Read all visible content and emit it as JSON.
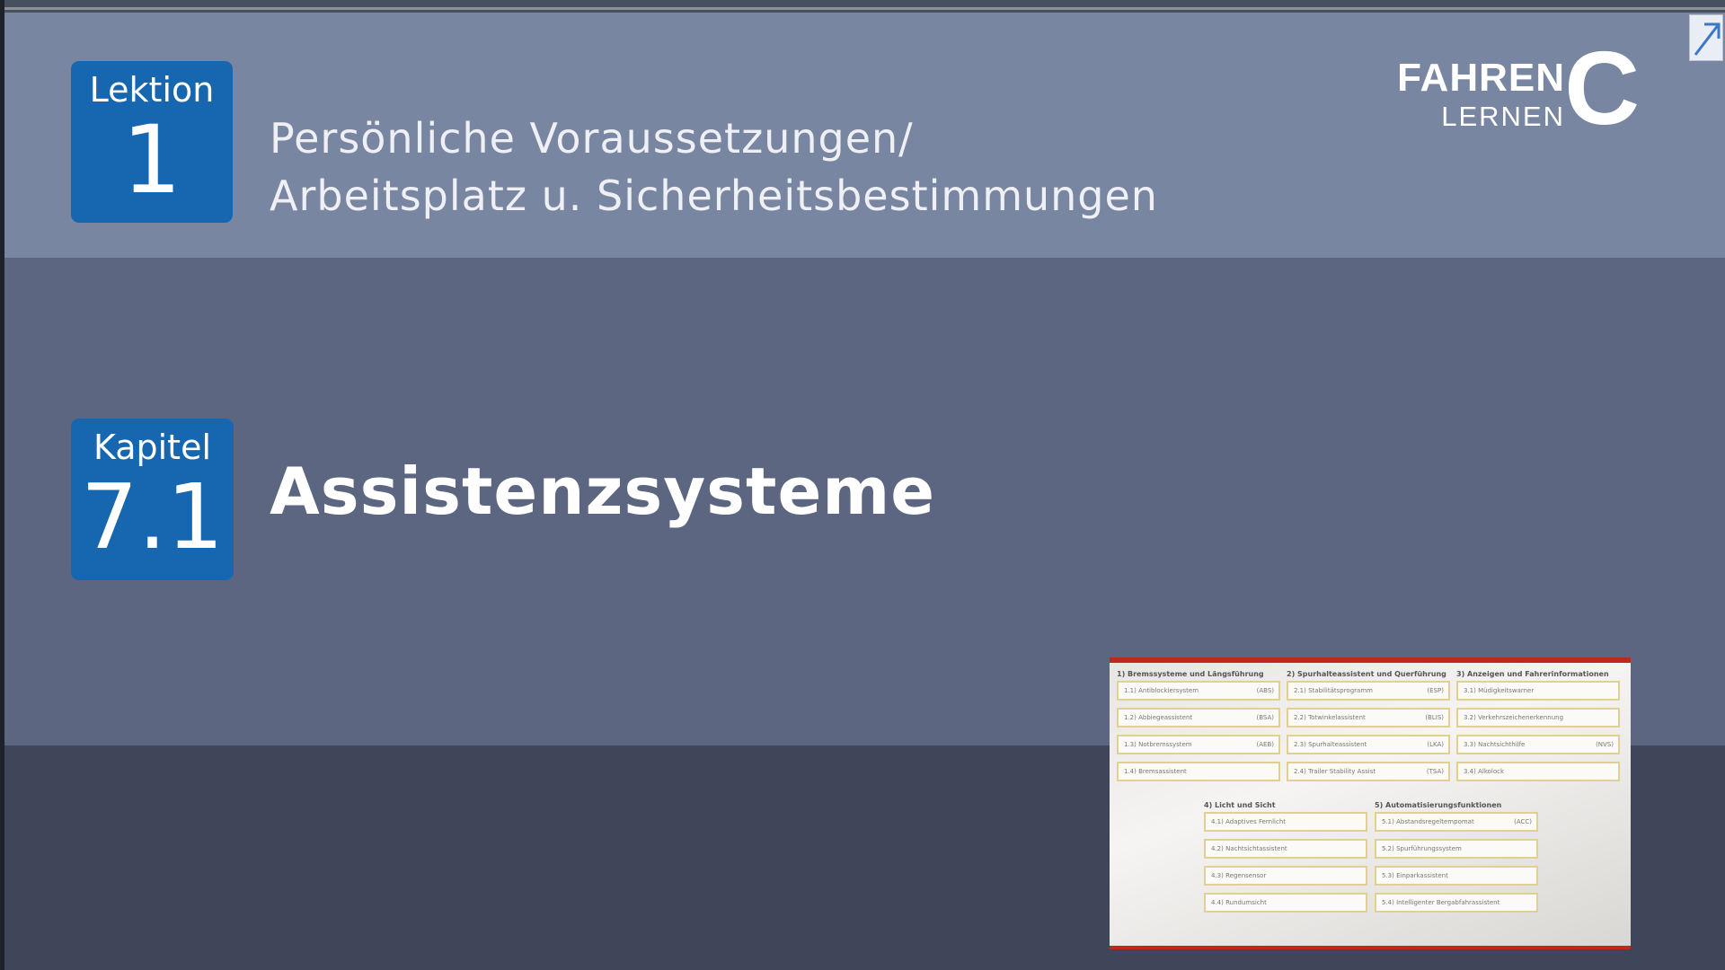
{
  "lesson": {
    "label": "Lektion",
    "number": "1",
    "title_line1": "Persönliche Voraussetzungen/",
    "title_line2": "Arbeitsplatz u. Sicherheitsbestimmungen"
  },
  "chapter": {
    "label": "Kapitel",
    "number": "7.1",
    "title": "Assistenzsysteme"
  },
  "brand": {
    "line1": "FAHREN",
    "line2": "LERNEN",
    "mark": "C"
  },
  "icons": {
    "corner": "expand-arrow-icon"
  },
  "colors": {
    "header_band": "#7886a1",
    "mid_band": "#5c6680",
    "bottom_band": "#404659",
    "badge_blue": "#1766b0",
    "thumbnail_accent": "#c0271e",
    "cell_border": "#e2cf92"
  },
  "thumbnail": {
    "sections": [
      {
        "heading": "1) Bremssysteme und Längsführung",
        "items": [
          {
            "label": "1.1) Antiblockiersystem",
            "code": "(ABS)"
          },
          {
            "label": "1.2) Abbiegeassistent",
            "code": "(BSA)"
          },
          {
            "label": "1.3) Notbremssystem",
            "code": "(AEB)"
          },
          {
            "label": "1.4) Bremsassistent",
            "code": ""
          }
        ]
      },
      {
        "heading": "2) Spurhalteassistent und Querführung",
        "items": [
          {
            "label": "2.1) Stabilitätsprogramm",
            "code": "(ESP)"
          },
          {
            "label": "2.2) Totwinkelassistent",
            "code": "(BLIS)"
          },
          {
            "label": "2.3) Spurhalteassistent",
            "code": "(LKA)"
          },
          {
            "label": "2.4) Trailer Stability Assist",
            "code": "(TSA)"
          }
        ]
      },
      {
        "heading": "3) Anzeigen und Fahrerinformationen",
        "items": [
          {
            "label": "3.1) Müdigkeitswarner",
            "code": ""
          },
          {
            "label": "3.2) Verkehrszeichenerkennung",
            "code": ""
          },
          {
            "label": "3.3) Nachtsichthilfe",
            "code": "(NVS)"
          },
          {
            "label": "3.4) Alkolock",
            "code": ""
          }
        ]
      },
      {
        "heading": "4) Licht und Sicht",
        "items": [
          {
            "label": "4.1) Adaptives Fernlicht",
            "code": ""
          },
          {
            "label": "4.2) Nachtsichtassistent",
            "code": ""
          },
          {
            "label": "4.3) Regensensor",
            "code": ""
          },
          {
            "label": "4.4) Rundumsicht",
            "code": ""
          }
        ]
      },
      {
        "heading": "5) Automatisierungsfunktionen",
        "items": [
          {
            "label": "5.1) Abstandsregeltempomat",
            "code": "(ACC)"
          },
          {
            "label": "5.2) Spurführungssystem",
            "code": ""
          },
          {
            "label": "5.3) Einparkassistent",
            "code": ""
          },
          {
            "label": "5.4) Intelligenter Bergabfahrassistent",
            "code": ""
          }
        ]
      }
    ]
  }
}
